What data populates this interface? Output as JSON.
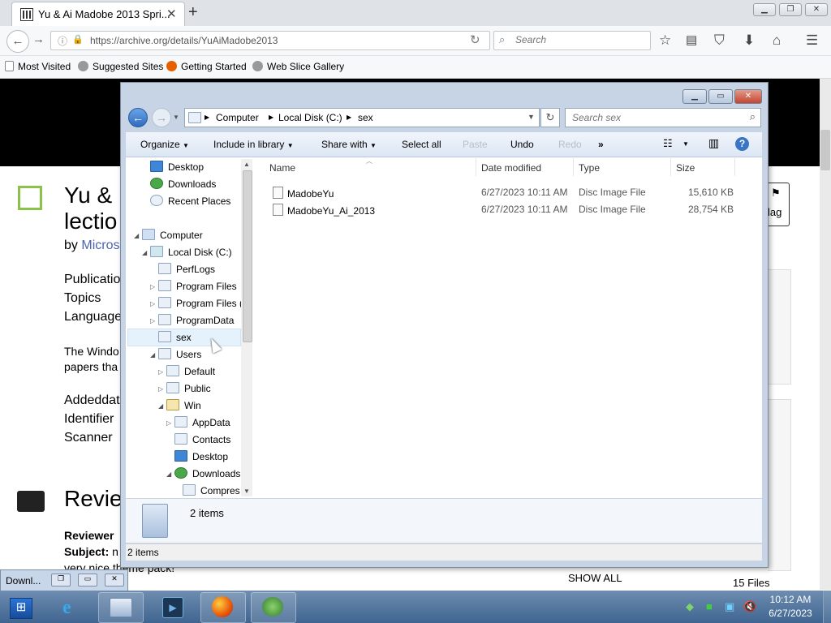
{
  "browser": {
    "tab_title": "Yu & Ai Madobe 2013 Spri...",
    "url": "https://archive.org/details/YuAiMadobe2013",
    "search_placeholder": "Search",
    "bookmarks": [
      "Most Visited",
      "Suggested Sites",
      "Getting Started",
      "Web Slice Gallery"
    ]
  },
  "page": {
    "title_line1": "Yu &",
    "title_line2": "lectio",
    "by_prefix": "by",
    "by_author": "Micros",
    "meta_labels": [
      "Publicatio",
      "Topics",
      "Language"
    ],
    "desc_line1": "The Windo",
    "desc_line2": "papers tha",
    "meta2_labels": [
      "Addeddat",
      "Identifier",
      "Scanner"
    ],
    "flag_label": "lag",
    "reviews_heading": "Revie",
    "reviewer_label": "Reviewer",
    "subject_label": "Subject:",
    "subject_value": "n",
    "review_text": "very nice theme pack!",
    "show_all": "SHOW ALL",
    "files_count": "15 Files"
  },
  "explorer": {
    "breadcrumb": [
      "Computer",
      "Local Disk (C:)",
      "sex"
    ],
    "search_placeholder": "Search sex",
    "commands": [
      "Organize",
      "Include in library",
      "Share with",
      "Select all",
      "Paste",
      "Undo",
      "Redo"
    ],
    "tree": [
      {
        "label": "Desktop"
      },
      {
        "label": "Downloads"
      },
      {
        "label": "Recent Places"
      },
      {
        "label": "Computer"
      },
      {
        "label": "Local Disk (C:)"
      },
      {
        "label": "PerfLogs"
      },
      {
        "label": "Program Files"
      },
      {
        "label": "Program Files ("
      },
      {
        "label": "ProgramData"
      },
      {
        "label": "sex"
      },
      {
        "label": "Users"
      },
      {
        "label": "Default"
      },
      {
        "label": "Public"
      },
      {
        "label": "Win"
      },
      {
        "label": "AppData"
      },
      {
        "label": "Contacts"
      },
      {
        "label": "Desktop"
      },
      {
        "label": "Downloads"
      },
      {
        "label": "Compres"
      }
    ],
    "columns": [
      "Name",
      "Date modified",
      "Type",
      "Size"
    ],
    "files": [
      {
        "name": "MadobeYu",
        "date": "6/27/2023 10:11 AM",
        "type": "Disc Image File",
        "size": "15,610 KB"
      },
      {
        "name": "MadobeYu_Ai_2013",
        "date": "6/27/2023 10:11 AM",
        "type": "Disc Image File",
        "size": "28,754 KB"
      }
    ],
    "details_count": "2 items",
    "status_count": "2 items"
  },
  "taskbar": {
    "minimized_label": "Downl...",
    "time": "10:12 AM",
    "date": "6/27/2023"
  }
}
